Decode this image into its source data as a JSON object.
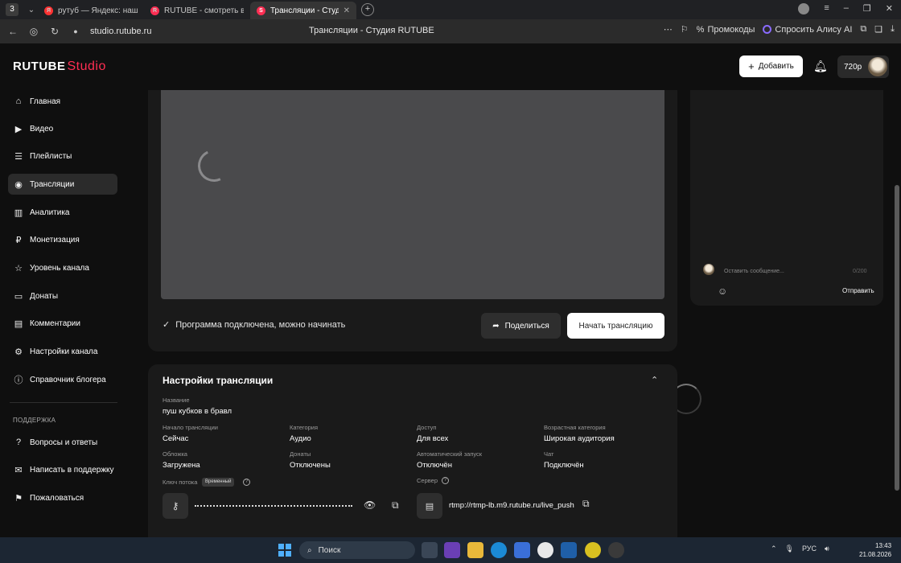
{
  "browser": {
    "tab_counter": "3",
    "tabs": [
      {
        "title": "рутуб — Яндекс: нашлос",
        "favicon": "yandex-icon",
        "color": "#ff3333"
      },
      {
        "title": "RUTUBE - смотреть видео",
        "favicon": "rutube-icon",
        "color": "#ff2e53"
      },
      {
        "title": "Трансляции - Студия R",
        "favicon": "rutube-studio-icon",
        "color": "#ff2e53"
      }
    ],
    "url": "studio.rutube.ru",
    "page_title": "Трансляции - Студия RUTUBE",
    "promo_label": "Промокоды",
    "alice_label": "Спросить Алису AI"
  },
  "header": {
    "logo_main": "RUTUBE",
    "logo_studio": "Studio",
    "add_label": "Добавить",
    "quality": "720p"
  },
  "sidebar": {
    "items": [
      {
        "label": "Главная",
        "icon": "home-icon"
      },
      {
        "label": "Видео",
        "icon": "video-icon"
      },
      {
        "label": "Плейлисты",
        "icon": "playlist-icon"
      },
      {
        "label": "Трансляции",
        "icon": "broadcast-icon",
        "active": true
      },
      {
        "label": "Аналитика",
        "icon": "analytics-icon"
      },
      {
        "label": "Монетизация",
        "icon": "monetization-icon"
      },
      {
        "label": "Уровень канала",
        "icon": "star-icon"
      },
      {
        "label": "Донаты",
        "icon": "donate-icon"
      },
      {
        "label": "Комментарии",
        "icon": "comment-icon"
      },
      {
        "label": "Настройки канала",
        "icon": "gear-icon"
      },
      {
        "label": "Справочник блогера",
        "icon": "info-icon"
      }
    ],
    "support_heading": "ПОДДЕРЖКА",
    "support_items": [
      {
        "label": "Вопросы и ответы",
        "icon": "question-icon"
      },
      {
        "label": "Написать в поддержку",
        "icon": "mail-icon"
      },
      {
        "label": "Пожаловаться",
        "icon": "flag-icon"
      }
    ]
  },
  "player": {
    "status": "Программа подключена, можно начинать",
    "share_label": "Поделиться",
    "start_label": "Начать трансляцию"
  },
  "chat": {
    "placeholder": "Оставить сообщение...",
    "counter": "0/200",
    "send_label": "Отправить"
  },
  "settings": {
    "title": "Настройки трансляции",
    "name_label": "Название",
    "name_value": "пуш кубков в бравл",
    "fields": [
      {
        "label": "Начало трансляции",
        "value": "Сейчас"
      },
      {
        "label": "Категория",
        "value": "Аудио"
      },
      {
        "label": "Доступ",
        "value": "Для всех"
      },
      {
        "label": "Возрастная категория",
        "value": "Широкая аудитория"
      },
      {
        "label": "Обложка",
        "value": "Загружена"
      },
      {
        "label": "Донаты",
        "value": "Отключены"
      },
      {
        "label": "Автоматический запуск",
        "value": "Отключён"
      },
      {
        "label": "Чат",
        "value": "Подключён"
      }
    ],
    "stream_key_label": "Ключ потока",
    "temp_badge": "Временный",
    "server_label": "Сервер",
    "server_url": "rtmp://rtmp-lb.m9.rutube.ru/live_push"
  },
  "taskbar": {
    "search_label": "Поиск",
    "lang": "РУС",
    "time": "13:43",
    "date": "21.08.2026"
  }
}
